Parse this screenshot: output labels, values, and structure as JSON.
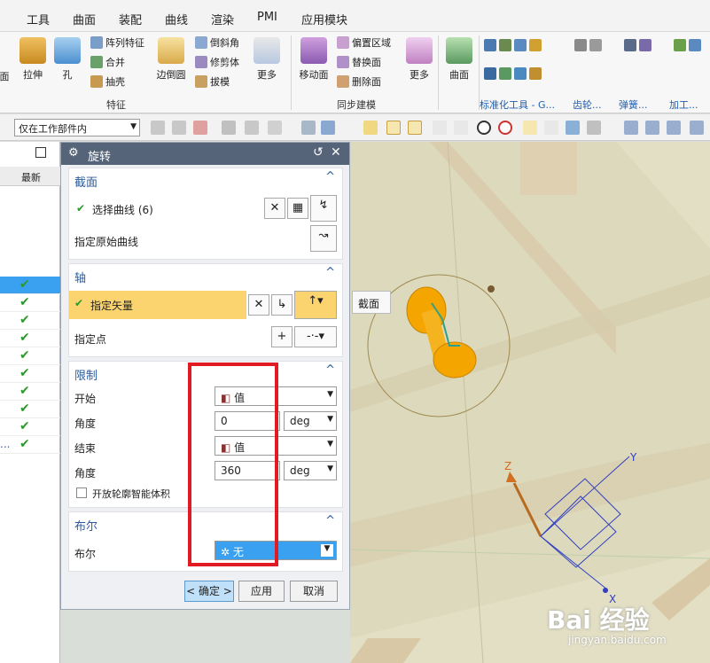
{
  "menu": [
    "工具",
    "曲面",
    "装配",
    "曲线",
    "渲染",
    "PMI",
    "应用模块"
  ],
  "ribbon": {
    "feature": {
      "extrude": "拉伸",
      "hole": "孔",
      "pattern": "阵列特征",
      "unite": "合并",
      "shell": "抽壳",
      "edge_blend": "边倒圆",
      "chamfer": "倒斜角",
      "trim_body": "修剪体",
      "draft": "拔模",
      "more": "更多",
      "group": "特征"
    },
    "sync": {
      "move_face": "移动面",
      "offset_region": "偏置区域",
      "replace_face": "替换面",
      "delete_face": "删除面",
      "more": "更多",
      "group": "同步建模"
    },
    "surface": "曲面",
    "std_tools": "标准化工具 - G...",
    "gear": "齿轮...",
    "spring": "弹簧...",
    "machining": "加工...",
    "left_cut": "面"
  },
  "filter": "仅在工作部件内",
  "nav": {
    "header": "最新",
    "checks": 10,
    "ellipsis": "..."
  },
  "dialog": {
    "title": "旋转",
    "section": {
      "title": "截面",
      "select_curve": "选择曲线 (6)",
      "orig_curve": "指定原始曲线"
    },
    "axis": {
      "title": "轴",
      "vector": "指定矢量",
      "point": "指定点"
    },
    "limits": {
      "title": "限制",
      "start": "开始",
      "start_value": "值",
      "angle1": "角度",
      "angle1_value": "0",
      "unit1": "deg",
      "end": "结束",
      "end_value": "值",
      "angle2": "角度",
      "angle2_value": "360",
      "unit2": "deg",
      "open_profile": "开放轮廓智能体积"
    },
    "boolean": {
      "title": "布尔",
      "label": "布尔",
      "value": "无"
    },
    "buttons": {
      "ok": "< 确定 >",
      "apply": "应用",
      "cancel": "取消"
    }
  },
  "viewport": {
    "tooltip": "截面",
    "axes": {
      "x": "X",
      "y": "Y",
      "z": "Z"
    },
    "watermark": "Bai 经验",
    "watermark_url": "jingyan.baidu.com"
  },
  "colors": {
    "accent": "#2b5c98",
    "highlight": "#fbd46f",
    "selected": "#3aa0f0",
    "check": "#2b9a2b",
    "title_bar": "#556478",
    "annotation": "#e01b24",
    "model": "#f5a500"
  }
}
